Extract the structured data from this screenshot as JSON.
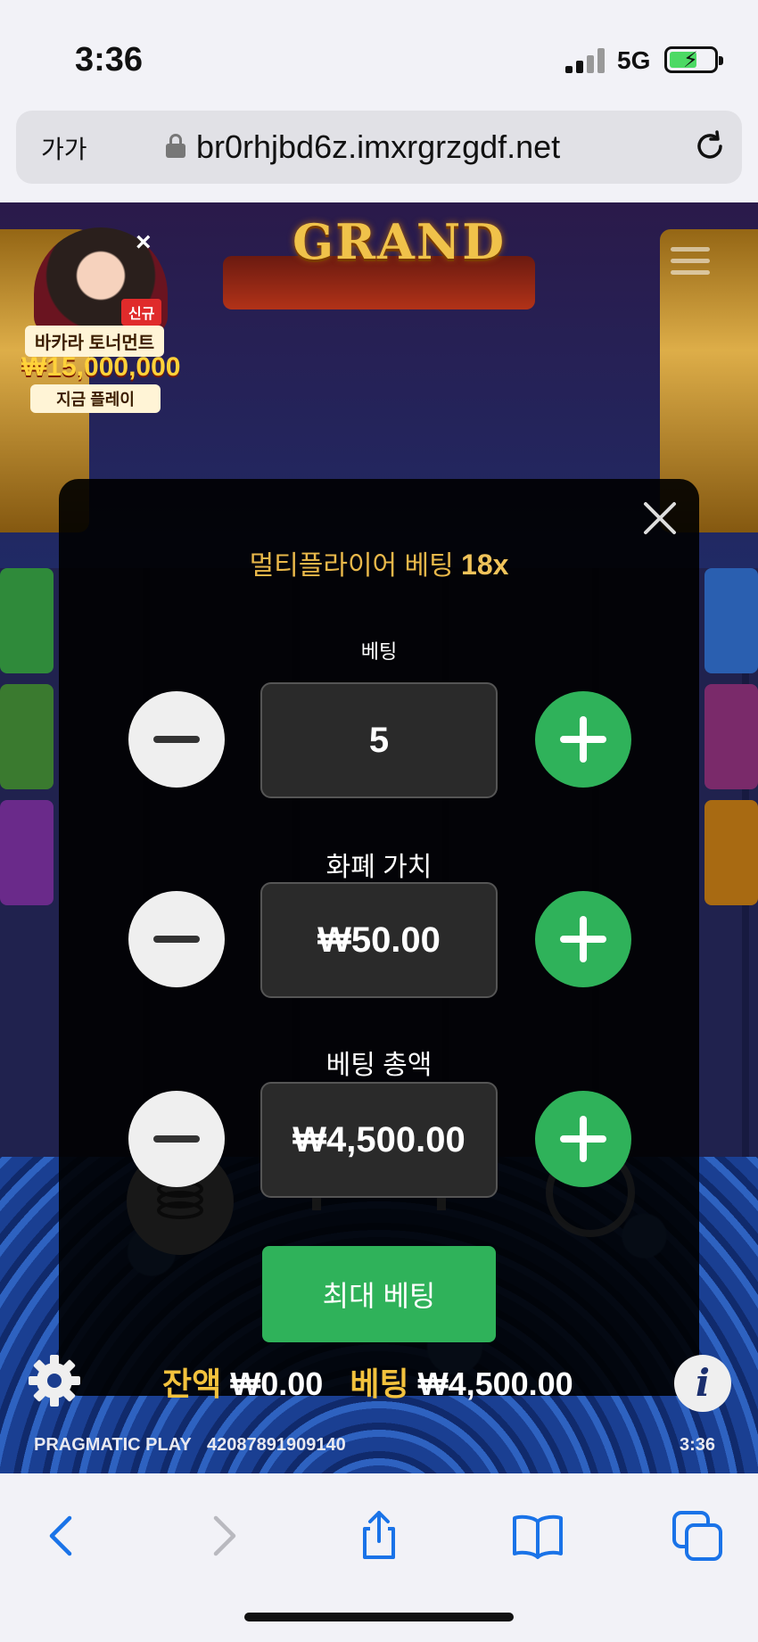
{
  "status_bar": {
    "time": "3:36",
    "network": "5G"
  },
  "browser": {
    "text_size_label": "가가",
    "url": "br0rhjbd6z.imxrgrzgdf.net"
  },
  "game": {
    "jackpot_label": "GRAND",
    "promo": {
      "tag": "신규",
      "title": "바카라 토너먼트",
      "amount": "₩15,000,000",
      "cta": "지금 플레이"
    },
    "modal": {
      "title": "멀티플라이어 베팅",
      "multiplier": "18x",
      "bet_label": "베팅",
      "bet_value": "5",
      "coin_value_label": "화폐 가치",
      "coin_value": "₩50.00",
      "total_bet_label": "베팅 총액",
      "total_bet": "₩4,500.00",
      "max_bet_label": "최대 베팅"
    },
    "bottom_bar": {
      "balance_label": "잔액",
      "balance_value": "₩0.00",
      "bet_label": "베팅",
      "bet_value": "₩4,500.00",
      "brand": "PRAGMATIC PLAY",
      "game_id": "42087891909140",
      "clock": "3:36"
    }
  },
  "colors": {
    "accent_green": "#2fb25a",
    "gold": "#f3c23d",
    "modal_bg": "#000000"
  },
  "icons": [
    "settings-gear-icon",
    "info-icon",
    "coins-icon",
    "close-icon",
    "minus-icon",
    "plus-icon",
    "back-icon",
    "forward-icon",
    "share-icon",
    "bookmarks-icon",
    "tabs-icon",
    "reload-icon",
    "lock-icon"
  ]
}
